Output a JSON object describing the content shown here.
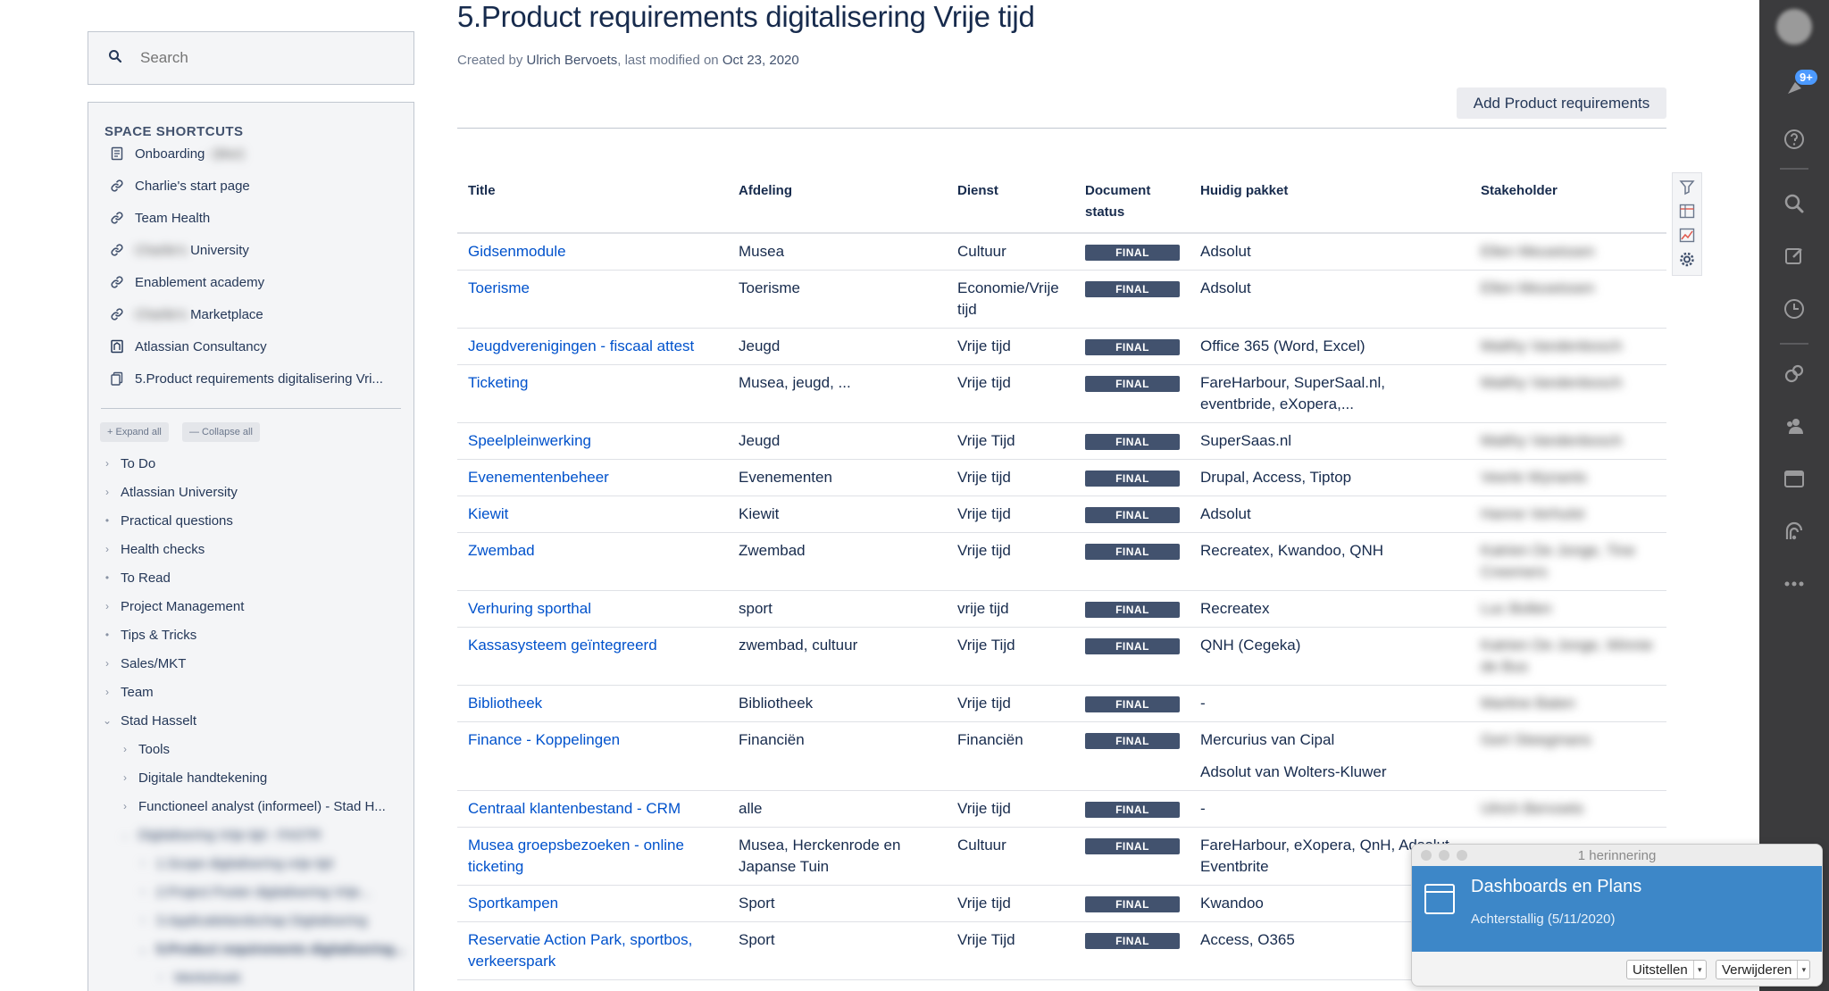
{
  "sidebar": {
    "search_placeholder": "Search",
    "shortcuts_title": "SPACE SHORTCUTS",
    "shortcuts": [
      {
        "label": "Onboarding",
        "suffix": " - (blur)",
        "icon": "page-icon"
      },
      {
        "label": "Charlie's start page",
        "icon": "link-icon"
      },
      {
        "label": "Team Health",
        "icon": "link-icon"
      },
      {
        "label": "University",
        "prefix": "Charlie's",
        "icon": "link-icon"
      },
      {
        "label": "Enablement academy",
        "icon": "link-icon"
      },
      {
        "label": "Marketplace",
        "prefix": "Charlie's",
        "icon": "link-icon"
      },
      {
        "label": "Atlassian Consultancy",
        "icon": "space-icon"
      },
      {
        "label": "5.Product requirements digitalisering Vri...",
        "icon": "pages-icon"
      }
    ],
    "expand_all": "+ Expand all",
    "collapse_all": "— Collapse all",
    "tree": [
      {
        "label": "To Do"
      },
      {
        "label": "Atlassian University"
      },
      {
        "label": "Practical questions"
      },
      {
        "label": "Health checks"
      },
      {
        "label": "To Read"
      },
      {
        "label": "Project Management"
      },
      {
        "label": "Tips & Tricks"
      },
      {
        "label": "Sales/MKT"
      },
      {
        "label": "Team"
      },
      {
        "label": "Stad Hasselt"
      },
      {
        "label": "Tools"
      },
      {
        "label": "Digitale handtekening"
      },
      {
        "label": "Functioneel analyst (informeel) - Stad H..."
      },
      {
        "label": "Digitalisering Vrije tijd - FASTR"
      },
      {
        "label": "1.Scope digitalisering vrije tijd"
      },
      {
        "label": "2.Project Poster digitalisering Vrije..."
      },
      {
        "label": "3.Applicatielandschap Digitalisering"
      },
      {
        "label": "5.Product requirements digitalisering..."
      },
      {
        "label": "Werkshoek"
      }
    ]
  },
  "page": {
    "title": "5.Product requirements digitalisering Vrije tijd",
    "byline_created": "Created by",
    "author": "Ulrich Bervoets",
    "byline_modified": ", last modified on",
    "modified_date": "Oct 23, 2020",
    "add_button": "Add Product requirements"
  },
  "table": {
    "headers": [
      "Title",
      "Afdeling",
      "Dienst",
      "Document status",
      "Huidig pakket",
      "Stakeholder"
    ],
    "status_label": "FINAL",
    "rows": [
      {
        "title": "Gidsenmodule",
        "afdeling": "Musea",
        "dienst": "Cultuur",
        "pakket": "Adsolut",
        "stakeholder": "Ellen Meuwissen"
      },
      {
        "title": "Toerisme",
        "afdeling": "Toerisme",
        "dienst": "Economie/Vrije tijd",
        "pakket": "Adsolut",
        "stakeholder": "Ellen Meuwissen"
      },
      {
        "title": "Jeugdverenigingen - fiscaal attest",
        "afdeling": "Jeugd",
        "dienst": "Vrije tijd",
        "pakket": "Office 365 (Word, Excel)",
        "stakeholder": "Matthy Vandenbosch"
      },
      {
        "title": "Ticketing",
        "afdeling": "Musea, jeugd, ...",
        "dienst": "Vrije tijd",
        "pakket": "FareHarbour, SuperSaal.nl, eventbride, eXopera,...",
        "stakeholder": "Matthy Vandenbosch"
      },
      {
        "title": "Speelpleinwerking",
        "afdeling": "Jeugd",
        "dienst": "Vrije Tijd",
        "pakket": "SuperSaas.nl",
        "stakeholder": "Matthy Vandenbosch"
      },
      {
        "title": "Evenementenbeheer",
        "afdeling": "Evenementen",
        "dienst": "Vrije tijd",
        "pakket": "Drupal, Access, Tiptop",
        "stakeholder": "Veerle Wynants"
      },
      {
        "title": "Kiewit",
        "afdeling": "Kiewit",
        "dienst": "Vrije tijd",
        "pakket": "Adsolut",
        "stakeholder": "Hanne Verhulst"
      },
      {
        "title": "Zwembad",
        "afdeling": "Zwembad",
        "dienst": "Vrije tijd",
        "pakket": "Recreatex, Kwandoo, QNH",
        "stakeholder": "Katrien De Jonge, Tine Creemers"
      },
      {
        "title": "Verhuring sporthal",
        "afdeling": "sport",
        "dienst": "vrije tijd",
        "pakket": "Recreatex",
        "stakeholder": "Luc Bollen"
      },
      {
        "title": "Kassasysteem geïntegreerd",
        "afdeling": "zwembad, cultuur",
        "dienst": "Vrije Tijd",
        "pakket": "QNH (Cegeka)",
        "stakeholder": "Katrien De Jonge, Winnie de Bus"
      },
      {
        "title": "Bibliotheek",
        "afdeling": "Bibliotheek",
        "dienst": "Vrije tijd",
        "pakket": "-",
        "stakeholder": "Martine Baten"
      },
      {
        "title": "Finance - Koppelingen",
        "afdeling": "Financiën",
        "dienst": "Financiën",
        "pakket": "Mercurius van Cipal",
        "pakket2": "Adsolut van Wolters-Kluwer",
        "stakeholder": "Gert Steegmans"
      },
      {
        "title": "Centraal klantenbestand - CRM",
        "afdeling": "alle",
        "dienst": "Vrije tijd",
        "pakket": "-",
        "stakeholder": "Ulrich Bervoets"
      },
      {
        "title": "Musea groepsbezoeken - online ticketing",
        "afdeling": "Musea, Herckenrode en Japanse Tuin",
        "dienst": "Cultuur",
        "pakket": "FareHarbour, eXopera, QnH, Adsolut, Eventbrite",
        "stakeholder": ""
      },
      {
        "title": "Sportkampen",
        "afdeling": "Sport",
        "dienst": "Vrije tijd",
        "pakket": "Kwandoo",
        "stakeholder": ""
      },
      {
        "title": "Reservatie Action Park, sportbos, verkeerspark",
        "afdeling": "Sport",
        "dienst": "Vrije Tijd",
        "pakket": "Access, O365",
        "stakeholder": ""
      }
    ]
  },
  "rail": {
    "notifications_badge": "9+",
    "icons": [
      "avatar",
      "notifications-icon",
      "help-icon",
      "search-icon",
      "create-icon",
      "recent-icon",
      "feedback-icon",
      "people-icon",
      "calendar-icon",
      "analytics-icon",
      "more-icon"
    ]
  },
  "reminder": {
    "window_title": "1 herinnering",
    "title": "Dashboards en Plans",
    "subtitle": "Achterstallig (5/11/2020)",
    "snooze": "Uitstellen",
    "delete": "Verwijderen"
  },
  "colors": {
    "link": "#0052cc",
    "status_lozenge": "#42526e",
    "rail_bg": "#3b3b3d",
    "reminder_bg": "#3d87c8"
  }
}
